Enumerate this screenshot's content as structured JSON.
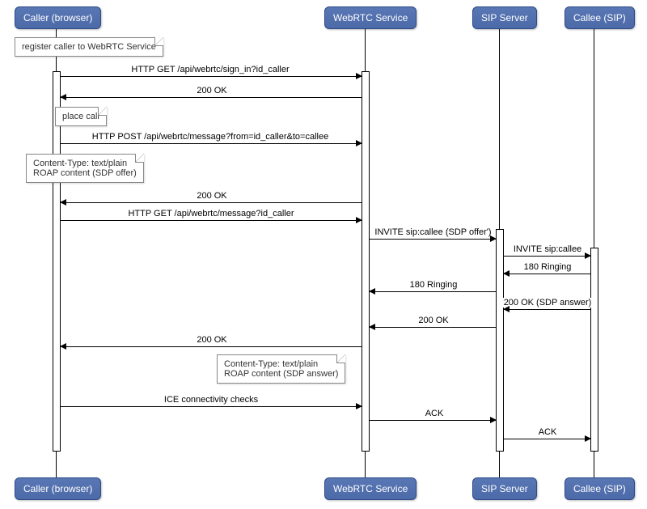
{
  "participants": {
    "caller": "Caller (browser)",
    "webrtc": "WebRTC Service",
    "sip": "SIP Server",
    "callee": "Callee (SIP)"
  },
  "notes": {
    "register": "register caller to WebRTC Service",
    "place_call": "place call",
    "offer_body_line1": "Content-Type: text/plain",
    "offer_body_line2": "ROAP content (SDP offer)",
    "answer_body_line1": "Content-Type: text/plain",
    "answer_body_line2": "ROAP content (SDP answer)"
  },
  "messages": {
    "sign_in": "HTTP GET /api/webrtc/sign_in?id_caller",
    "ok1": "200 OK",
    "post_msg": "HTTP POST /api/webrtc/message?from=id_caller&to=callee",
    "ok2": "200 OK",
    "get_msg": "HTTP GET /api/webrtc/message?id_caller",
    "invite1": "INVITE sip:callee (SDP offer')",
    "invite2": "INVITE sip:callee",
    "ringing1": "180 Ringing",
    "ringing2": "180 Ringing",
    "ok_answer": "200 OK (SDP answer)",
    "ok3": "200 OK",
    "ok4": "200 OK",
    "ice": "ICE connectivity checks",
    "ack1": "ACK",
    "ack2": "ACK"
  }
}
